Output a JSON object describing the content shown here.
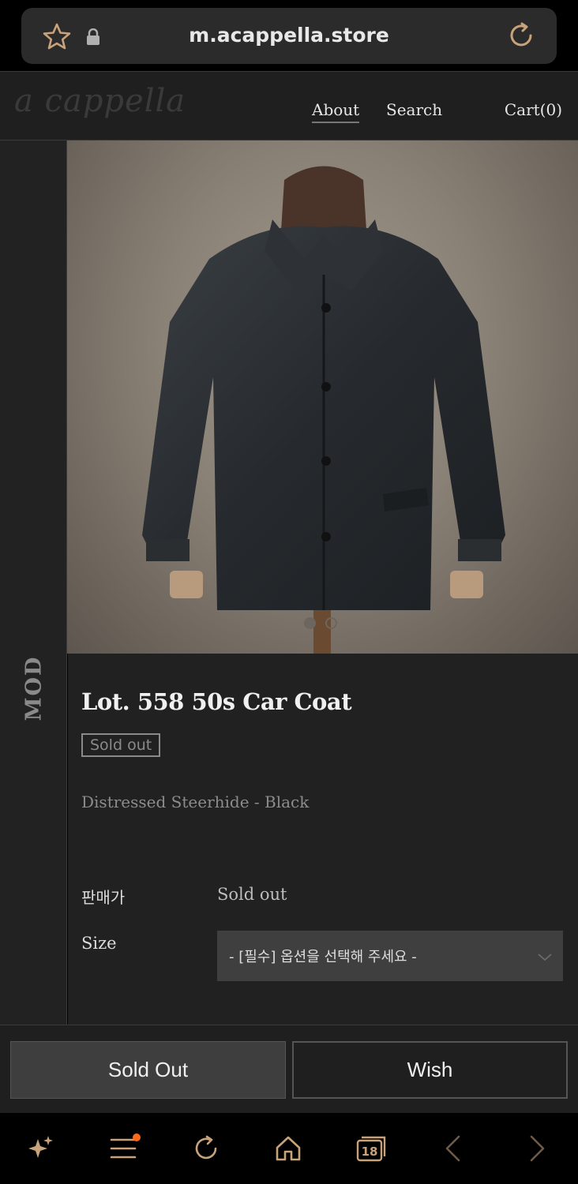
{
  "browser": {
    "url": "m.acappella.store",
    "tab_count": "18"
  },
  "header": {
    "logo": "a cappella",
    "nav": {
      "about": "About",
      "search": "Search",
      "cart": "Cart(0)"
    }
  },
  "side": {
    "label": "MOD"
  },
  "product": {
    "title": "Lot. 558 50s Car Coat",
    "badge": "Sold out",
    "subtitle": "Distressed Steerhide - Black",
    "carousel": {
      "count": 2,
      "active_index": 0
    },
    "price_label": "판매가",
    "price_value": "Sold out",
    "size_label": "Size",
    "size_placeholder": "- [필수] 옵션을 선택해 주세요 -"
  },
  "actions": {
    "sold_out": "Sold Out",
    "wish": "Wish"
  },
  "icons": {
    "bookmark": "star-icon",
    "secure": "lock-icon",
    "reload": "reload-icon",
    "select_arrow": "chevron-down-icon",
    "bottom_bar": [
      "sparkle-icon",
      "menu-icon",
      "refresh-icon",
      "home-icon",
      "tabs-icon",
      "back-icon",
      "forward-icon"
    ]
  },
  "colors": {
    "accent": "#c8a27a",
    "background": "#212121",
    "notification": "#ff6a1a"
  }
}
